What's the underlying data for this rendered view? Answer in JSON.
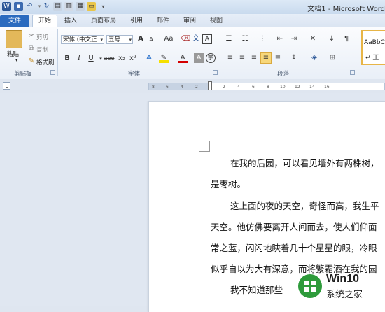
{
  "title_bar": {
    "document_title": "文档1 - Microsoft Word"
  },
  "tabs": [
    {
      "label": "文件"
    },
    {
      "label": "开始"
    },
    {
      "label": "插入"
    },
    {
      "label": "页面布局"
    },
    {
      "label": "引用"
    },
    {
      "label": "邮件"
    },
    {
      "label": "审阅"
    },
    {
      "label": "视图"
    }
  ],
  "clipboard": {
    "paste": "粘贴",
    "cut": "剪切",
    "copy": "复制",
    "format_painter": "格式刷",
    "group_label": "剪贴板"
  },
  "font": {
    "font_name": "宋体 (中文正",
    "font_size": "五号",
    "grow": "A",
    "shrink": "A",
    "change_case": "Aa",
    "bold": "B",
    "italic": "I",
    "underline": "U",
    "strike": "abe",
    "subscript": "x₂",
    "superscript": "x²",
    "group_label": "字体"
  },
  "paragraph": {
    "group_label": "段落"
  },
  "styles": {
    "preview": "AaBbC",
    "style_name": "正"
  },
  "ruler": {
    "ticks": [
      "8",
      "6",
      "4",
      "2",
      "2",
      "4",
      "6",
      "8",
      "10",
      "12",
      "14",
      "16"
    ]
  },
  "document": {
    "lines": [
      "在我的后园，可以看见墙外有两株树，",
      "是枣树。",
      "这上面的夜的天空，奇怪而高，我生平",
      "天空。他仿佛要离开人间而去，使人们仰面",
      "常之蓝，闪闪地䀹着几十个星星的眼，冷眼",
      "似乎自以为大有深意，而将繁霜洒在我的园",
      "我不知道那些"
    ]
  },
  "watermark": {
    "line1": "Win10",
    "line2": "系统之家"
  },
  "colors": {
    "file_tab": "#2b6bbf",
    "ribbon_bg": "#e9eff7",
    "watermark_green": "#2e9b3b"
  }
}
